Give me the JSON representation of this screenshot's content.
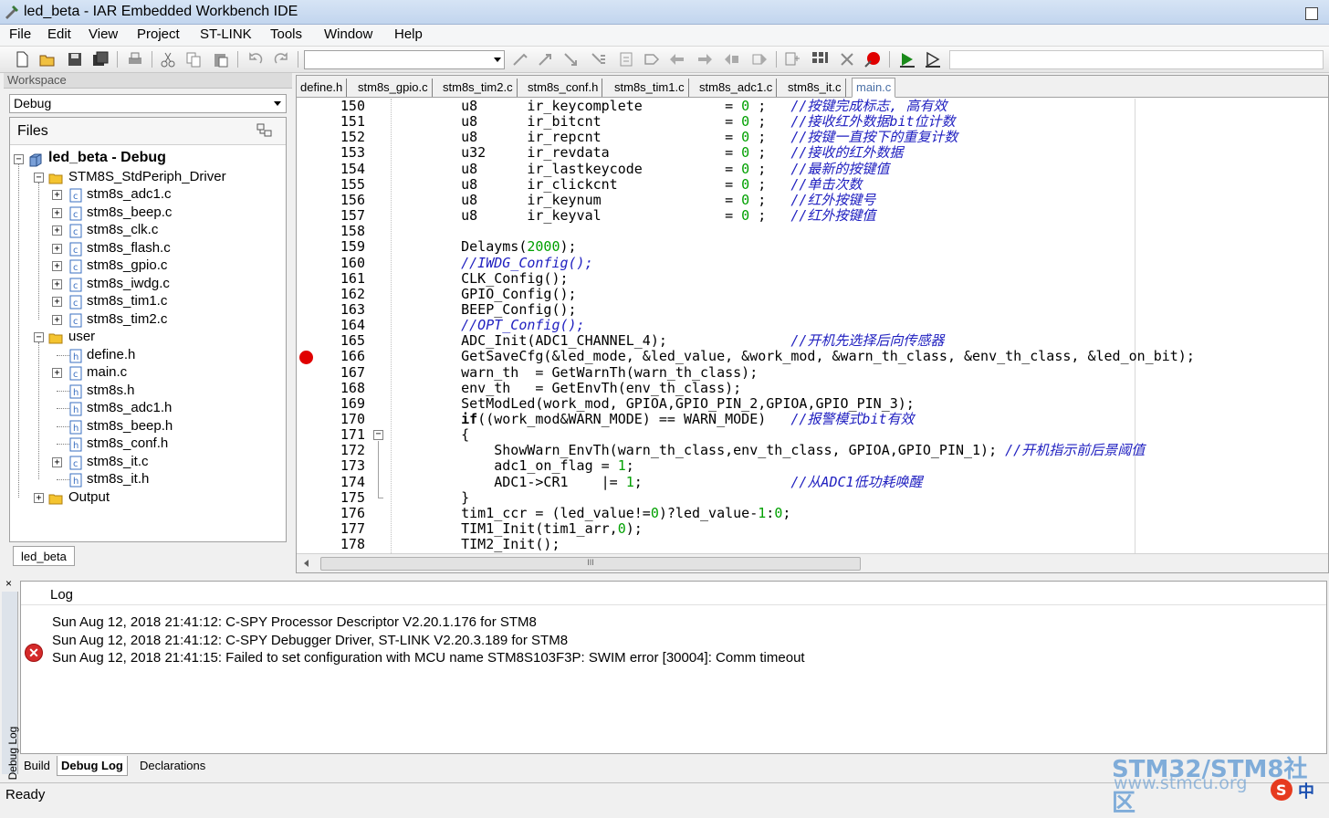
{
  "window": {
    "title": "led_beta - IAR Embedded Workbench IDE"
  },
  "menu": [
    "File",
    "Edit",
    "View",
    "Project",
    "ST-LINK",
    "Tools",
    "Window",
    "Help"
  ],
  "workspace": {
    "header": "Workspace",
    "config": "Debug",
    "files_label": "Files",
    "root": "led_beta - Debug",
    "driver_group": "STM8S_StdPeriph_Driver",
    "driver_files": [
      "stm8s_adc1.c",
      "stm8s_beep.c",
      "stm8s_clk.c",
      "stm8s_flash.c",
      "stm8s_gpio.c",
      "stm8s_iwdg.c",
      "stm8s_tim1.c",
      "stm8s_tim2.c"
    ],
    "user_group": "user",
    "user_files": [
      "define.h",
      "main.c",
      "stm8s.h",
      "stm8s_adc1.h",
      "stm8s_beep.h",
      "stm8s_conf.h",
      "stm8s_it.c",
      "stm8s_it.h"
    ],
    "output_group": "Output",
    "tab": "led_beta"
  },
  "editor": {
    "tabs": [
      "define.h",
      "stm8s_gpio.c",
      "stm8s_tim2.c",
      "stm8s_conf.h",
      "stm8s_tim1.c",
      "stm8s_adc1.c",
      "stm8s_it.c",
      "main.c"
    ],
    "active_tab": "main.c",
    "lines": [
      {
        "n": "150",
        "code": "    u8      ir_keycomplete          = 0 ;   ",
        "cmt": "//按键完成标志, 高有效"
      },
      {
        "n": "151",
        "code": "    u8      ir_bitcnt               = 0 ;   ",
        "cmt": "//接收红外数据bit位计数"
      },
      {
        "n": "152",
        "code": "    u8      ir_repcnt               = 0 ;   ",
        "cmt": "//按键一直按下的重复计数"
      },
      {
        "n": "153",
        "code": "    u32     ir_revdata              = 0 ;   ",
        "cmt": "//接收的红外数据"
      },
      {
        "n": "154",
        "code": "    u8      ir_lastkeycode          = 0 ;   ",
        "cmt": "//最新的按键值"
      },
      {
        "n": "155",
        "code": "    u8      ir_clickcnt             = 0 ;   ",
        "cmt": "//单击次数"
      },
      {
        "n": "156",
        "code": "    u8      ir_keynum               = 0 ;   ",
        "cmt": "//红外按键号"
      },
      {
        "n": "157",
        "code": "    u8      ir_keyval               = 0 ;   ",
        "cmt": "//红外按键值"
      },
      {
        "n": "158",
        "code": "",
        "cmt": ""
      },
      {
        "n": "159",
        "code": "    Delayms(2000);",
        "cmt": ""
      },
      {
        "n": "160",
        "code": "    ",
        "cmt": "//IWDG_Config();"
      },
      {
        "n": "161",
        "code": "    CLK_Config();",
        "cmt": ""
      },
      {
        "n": "162",
        "code": "    GPIO_Config();",
        "cmt": ""
      },
      {
        "n": "163",
        "code": "    BEEP_Config();",
        "cmt": ""
      },
      {
        "n": "164",
        "code": "    ",
        "cmt": "//OPT_Config();"
      },
      {
        "n": "165",
        "code": "    ADC_Init(ADC1_CHANNEL_4);               ",
        "cmt": "//开机先选择后向传感器"
      },
      {
        "n": "166",
        "code": "    GetSaveCfg(&led_mode, &led_value, &work_mod, &warn_th_class, &env_th_class, &led_on_bit);",
        "cmt": ""
      },
      {
        "n": "167",
        "code": "    warn_th  = GetWarnTh(warn_th_class);",
        "cmt": ""
      },
      {
        "n": "168",
        "code": "    env_th   = GetEnvTh(env_th_class);",
        "cmt": ""
      },
      {
        "n": "169",
        "code": "    SetModLed(work_mod, GPIOA,GPIO_PIN_2,GPIOA,GPIO_PIN_3);",
        "cmt": ""
      },
      {
        "n": "170",
        "code": "    if((work_mod&WARN_MODE) == WARN_MODE)   ",
        "cmt": "//报警模式bit有效"
      },
      {
        "n": "171",
        "code": "    {",
        "cmt": ""
      },
      {
        "n": "172",
        "code": "        ShowWarn_EnvTh(warn_th_class,env_th_class, GPIOA,GPIO_PIN_1); ",
        "cmt": "//开机指示前后景阈值"
      },
      {
        "n": "173",
        "code": "        adc1_on_flag = 1;",
        "cmt": ""
      },
      {
        "n": "174",
        "code": "        ADC1->CR1    |= 1;                  ",
        "cmt": "//从ADC1低功耗唤醒"
      },
      {
        "n": "175",
        "code": "    }",
        "cmt": ""
      },
      {
        "n": "176",
        "code": "    tim1_ccr = (led_value!=0)?led_value-1:0;",
        "cmt": ""
      },
      {
        "n": "177",
        "code": "    TIM1_Init(tim1_arr,0);",
        "cmt": ""
      },
      {
        "n": "178",
        "code": "    TIM2_Init();",
        "cmt": ""
      }
    ],
    "hscroll_label": "III"
  },
  "log": {
    "close": "×",
    "side_label": "Debug Log",
    "header": "Log",
    "lines": [
      "Sun Aug 12, 2018 21:41:12: C-SPY Processor Descriptor V2.20.1.176 for STM8",
      "Sun Aug 12, 2018 21:41:12: C-SPY Debugger Driver, ST-LINK V2.20.3.189 for STM8",
      "Sun Aug 12, 2018 21:41:15: Failed to set configuration with MCU name STM8S103F3P: SWIM error [30004]: Comm timeout"
    ],
    "tabs": [
      "Build",
      "Debug Log",
      "Declarations"
    ],
    "active_tab": "Debug Log"
  },
  "status": {
    "text": "Ready"
  },
  "watermark": {
    "line1": "STM32/STM8社区",
    "line2": "www.stmcu.org"
  },
  "colors": {
    "breakpoint": "#e00000",
    "comment": "#2020c0",
    "number": "#00a000",
    "error": "#d42a2a"
  }
}
